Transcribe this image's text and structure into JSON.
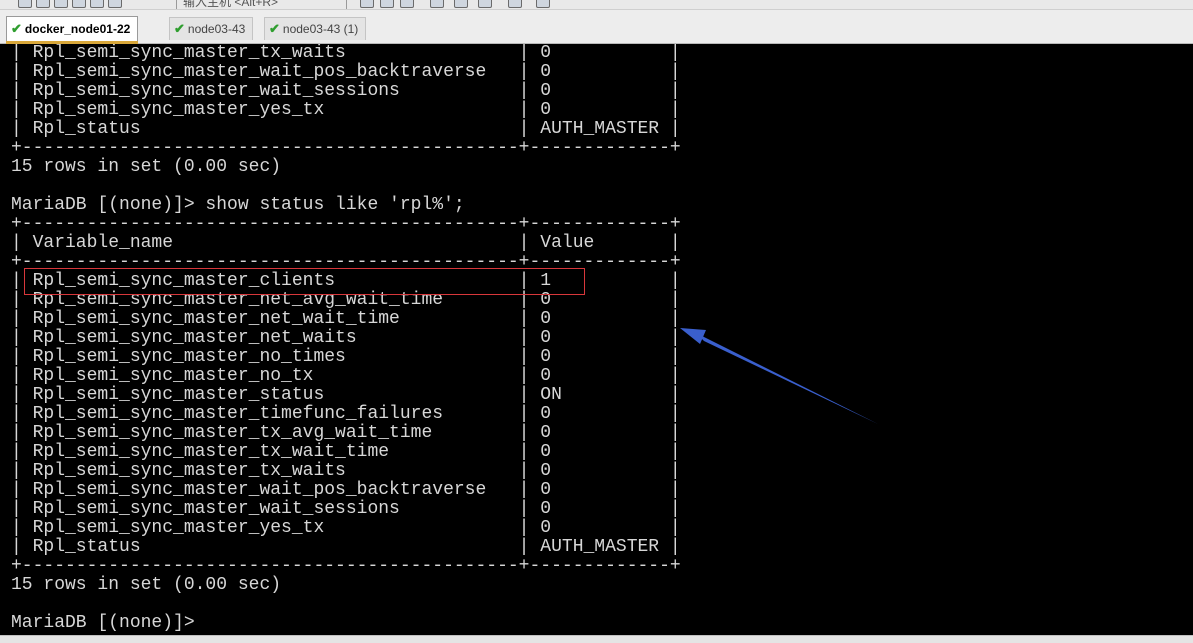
{
  "toolbar": {
    "hint": "输入主机 <Alt+R>"
  },
  "tabs": [
    {
      "label": "docker_node01-22",
      "active": true
    },
    {
      "label": "node03-43",
      "active": false
    },
    {
      "label": "node03-43 (1)",
      "active": false
    }
  ],
  "terminal": {
    "lines": [
      "| Rpl_semi_sync_master_tx_waits                | 0           |",
      "| Rpl_semi_sync_master_wait_pos_backtraverse   | 0           |",
      "| Rpl_semi_sync_master_wait_sessions           | 0           |",
      "| Rpl_semi_sync_master_yes_tx                  | 0           |",
      "| Rpl_status                                   | AUTH_MASTER |",
      "+----------------------------------------------+-------------+",
      "15 rows in set (0.00 sec)",
      "",
      "MariaDB [(none)]> show status like 'rpl%';",
      "+----------------------------------------------+-------------+",
      "| Variable_name                                | Value       |",
      "+----------------------------------------------+-------------+",
      "| Rpl_semi_sync_master_clients                 | 1           |",
      "| Rpl_semi_sync_master_net_avg_wait_time       | 0           |",
      "| Rpl_semi_sync_master_net_wait_time           | 0           |",
      "| Rpl_semi_sync_master_net_waits               | 0           |",
      "| Rpl_semi_sync_master_no_times                | 0           |",
      "| Rpl_semi_sync_master_no_tx                   | 0           |",
      "| Rpl_semi_sync_master_status                  | ON          |",
      "| Rpl_semi_sync_master_timefunc_failures       | 0           |",
      "| Rpl_semi_sync_master_tx_avg_wait_time        | 0           |",
      "| Rpl_semi_sync_master_tx_wait_time            | 0           |",
      "| Rpl_semi_sync_master_tx_waits                | 0           |",
      "| Rpl_semi_sync_master_wait_pos_backtraverse   | 0           |",
      "| Rpl_semi_sync_master_wait_sessions           | 0           |",
      "| Rpl_semi_sync_master_yes_tx                  | 0           |",
      "| Rpl_status                                   | AUTH_MASTER |",
      "+----------------------------------------------+-------------+",
      "15 rows in set (0.00 sec)",
      "",
      "MariaDB [(none)]> "
    ]
  },
  "colors": {
    "terminal_bg": "#000000",
    "terminal_fg": "#d7d7d7",
    "highlight_box": "#d8373b",
    "arrow": "#3a5fcd",
    "tab_check": "#2f9e2f",
    "active_tab_underline": "#d8a73a"
  },
  "icons": [
    "check-icon",
    "toolbar-icon",
    "arrow-annotation-icon"
  ]
}
